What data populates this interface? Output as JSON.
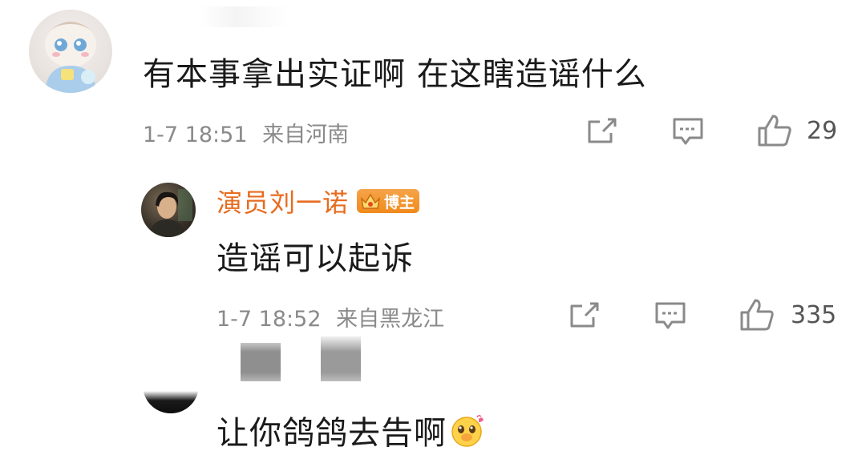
{
  "comment1": {
    "text": "有本事拿出实证啊 在这瞎造谣什么",
    "time": "1-7 18:51",
    "location": "来自河南",
    "likes": "29"
  },
  "reply1": {
    "username": "演员刘一诺",
    "badge": "博主",
    "text": "造谣可以起诉",
    "time": "1-7 18:52",
    "location": "来自黑龙江",
    "likes": "335"
  },
  "reply2": {
    "text": "让你鸽鸽去告啊"
  },
  "colors": {
    "username": "#e86b1f",
    "meta": "#8a8a8a",
    "text": "#1a1a1a",
    "badge": "#f08a1c"
  },
  "icons": [
    "share-icon",
    "comment-icon",
    "like-icon",
    "emoji-icon"
  ]
}
